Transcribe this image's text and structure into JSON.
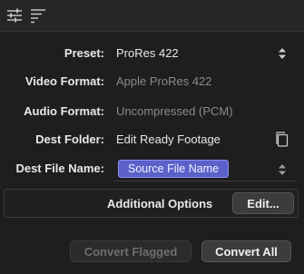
{
  "toolbar": {
    "left_icon": "sliders-icon",
    "right_icon": "sort-lines-icon"
  },
  "form": {
    "preset": {
      "label": "Preset:",
      "value": "ProRes 422"
    },
    "video_format": {
      "label": "Video Format:",
      "value": "Apple ProRes 422"
    },
    "audio_format": {
      "label": "Audio Format:",
      "value": "Uncompressed (PCM)"
    },
    "dest_folder": {
      "label": "Dest Folder:",
      "value": "Edit Ready Footage",
      "icon": "document-icon"
    },
    "dest_file_name": {
      "label": "Dest File Name:",
      "token": "Source File Name"
    }
  },
  "options": {
    "label": "Additional Options",
    "edit_button": "Edit..."
  },
  "actions": {
    "convert_flagged": "Convert Flagged",
    "convert_all": "Convert All"
  },
  "colors": {
    "background": "#1e1e1e",
    "token_fill": "#5b61c8",
    "token_border": "#8b90ee"
  }
}
